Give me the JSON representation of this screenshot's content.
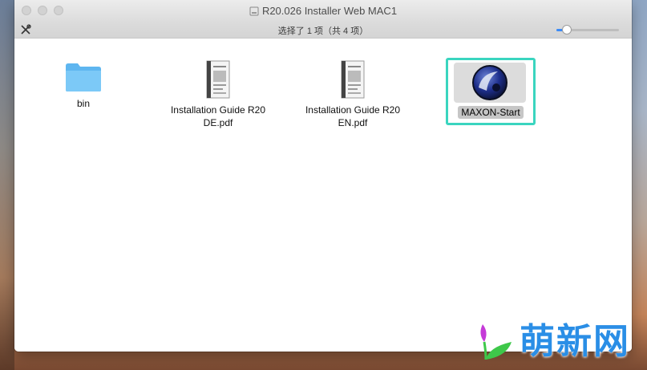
{
  "window": {
    "title": "R20.026 Installer Web MAC1"
  },
  "toolbar": {
    "status_text": "选择了 1 项（共 4 项）",
    "icon_size_slider_value": 0.17
  },
  "files": [
    {
      "name_line1": "bin",
      "name_line2": "",
      "type": "folder-icon",
      "selected": false
    },
    {
      "name_line1": "Installation Guide R20",
      "name_line2": "DE.pdf",
      "type": "pdf-document-icon",
      "selected": false
    },
    {
      "name_line1": "Installation Guide R20",
      "name_line2": "EN.pdf",
      "type": "pdf-document-icon",
      "selected": false
    },
    {
      "name_line1": "MAXON-Start",
      "name_line2": "",
      "type": "cinema4d-app-icon",
      "selected": true
    }
  ],
  "watermark": {
    "text": "萌新网"
  },
  "colors": {
    "selection_outline": "#3ad5bf",
    "folder": "#6ec0f5",
    "accent": "#3b8bf7",
    "watermark": "#2a8ee6"
  }
}
